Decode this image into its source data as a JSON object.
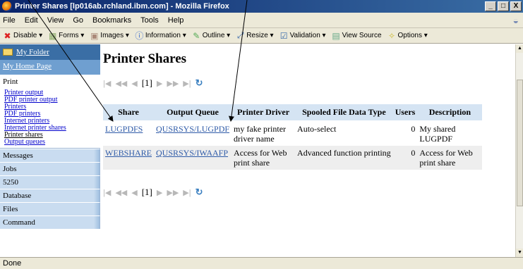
{
  "window": {
    "title": "Printer Shares [lp016ab.rchland.ibm.com] - Mozilla Firefox",
    "buttons": [
      "_",
      "□",
      "X"
    ]
  },
  "menubar": {
    "items": [
      "File",
      "Edit",
      "View",
      "Go",
      "Bookmarks",
      "Tools",
      "Help"
    ]
  },
  "devbar": {
    "items": [
      {
        "label": "Disable ▾",
        "icon": "✖"
      },
      {
        "label": "Forms ▾",
        "icon": "▦"
      },
      {
        "label": "Images ▾",
        "icon": "▣"
      },
      {
        "label": "Information ▾",
        "icon": "ⓘ"
      },
      {
        "label": "Outline ▾",
        "icon": "✎"
      },
      {
        "label": "Resize ▾",
        "icon": "⤢"
      },
      {
        "label": "Validation ▾",
        "icon": "☑"
      },
      {
        "label": "View Source",
        "icon": "▤"
      },
      {
        "label": "Options ▾",
        "icon": "✧"
      }
    ]
  },
  "nav": {
    "folder": "My Folder",
    "home": "My Home Page",
    "active_section": "Print",
    "print_items": [
      "Printer output",
      "PDF printer output",
      "Printers",
      "PDF printers",
      "Internet printers",
      "Internet printer shares",
      "Printer shares",
      "Output queues"
    ],
    "sections": [
      "Messages",
      "Jobs",
      "5250",
      "Database",
      "Files",
      "Command"
    ]
  },
  "main": {
    "title": "Printer Shares",
    "pager_page": "[1]",
    "columns": [
      "Share",
      "Output Queue",
      "Printer Driver",
      "Spooled File Data Type",
      "Users",
      "Description"
    ],
    "rows": [
      {
        "share": "LUGPDFS",
        "queue": "QUSRSYS/LUGPDF",
        "driver": "my fake printer driver name",
        "type": "Auto-select",
        "users": "0",
        "desc": "My shared LUGPDF"
      },
      {
        "share": "WEBSHARE",
        "queue": "QUSRSYS/IWAAFP",
        "driver": "Access for Web print share",
        "type": "Advanced function printing",
        "users": "0",
        "desc": "Access for Web print share"
      }
    ]
  },
  "status": {
    "text": "Done"
  },
  "colors": {
    "title_bar": "#0a246a",
    "nav_header": "#3a6ea5",
    "nav_section": "#c9dcf0",
    "table_header": "#d5e4f3",
    "link": "#2f5ba8"
  }
}
